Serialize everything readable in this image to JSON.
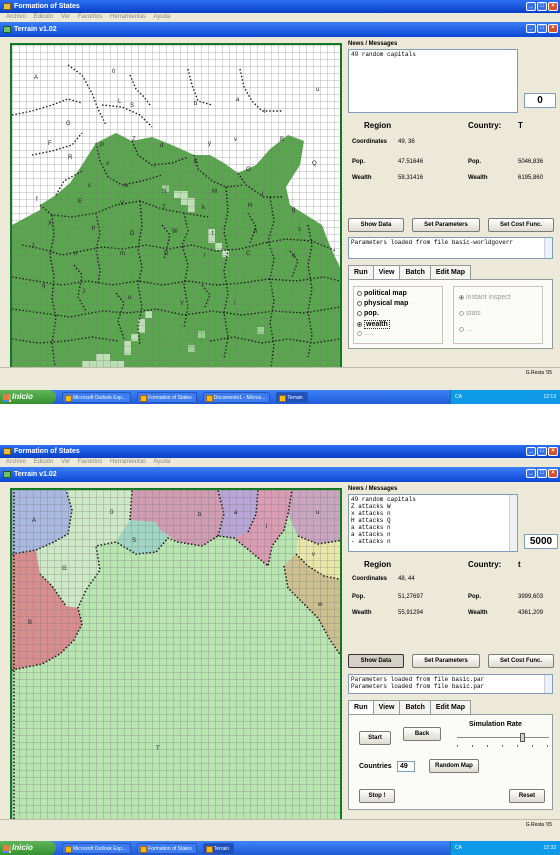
{
  "shot1": {
    "outer_title": "Formation of States",
    "menu": "Archivo Edición Ver Favoritos Herramientas Ayuda",
    "inner_title": "Terrain v1.02",
    "news_title": "News / Messages",
    "messages": [
      "49 random capitals"
    ],
    "counter": "0",
    "region_label": "Region",
    "country_label": "Country:",
    "country_value": "T",
    "coordinates_label": "Coordinates",
    "coordinates_value": "49, 36",
    "pop_label": "Pop.",
    "region_pop": "47.51646",
    "country_pop": "5046,836",
    "wealth_label": "Wealth",
    "region_wealth": "58,31416",
    "country_wealth": "6195,860",
    "btn_show_data": "Show Data",
    "btn_set_params": "Set Parameters",
    "btn_set_cost": "Set Cost Func.",
    "params_text": "Parameters loaded from file basic-worldgoverr",
    "tabs": [
      "Run",
      "View",
      "Batch",
      "Edit Map"
    ],
    "view_options": [
      "political map",
      "physical map",
      "pop.",
      "wealth",
      "....."
    ],
    "inspect_options": [
      "instant inspect",
      "stats",
      "..."
    ],
    "status_right": "G.Resta '05",
    "map_labels": [
      "A",
      "0",
      "L",
      "S",
      "b",
      "a",
      "l",
      "u",
      "G",
      "F",
      "P",
      "Z",
      "d",
      "y",
      "v",
      "B",
      "R",
      "x",
      "r",
      "K",
      "O",
      "Q",
      "c",
      "w",
      "N",
      "M",
      "j",
      "f",
      "E",
      "V",
      "T",
      "k",
      "H",
      "g",
      "X",
      "p",
      "D",
      "W",
      "t",
      "h",
      "s",
      "z",
      "n",
      "m",
      "U",
      "I",
      "C",
      "e",
      "q",
      "J",
      "o",
      "Y",
      "i"
    ],
    "taskbar": {
      "start": "Inicio",
      "items": [
        "Microsoft Outlook Exp...",
        "Formation of States",
        "Documento1 - Micros...",
        "Terrain"
      ],
      "tray": "CA",
      "clock": "12:13"
    }
  },
  "shot2": {
    "outer_title": "Formation of States",
    "menu": "Archivo Edición Ver Favoritos Herramientas Ayuda",
    "inner_title": "Terrain v1.02",
    "news_title": "News / Messages",
    "messages": [
      "49 random capitals",
      "Z attacks W",
      "x attacks n",
      "H attacks Q",
      "a attacks n",
      "a attacks n",
      "- attacks n"
    ],
    "counter": "5000",
    "region_label": "Region",
    "country_label": "Country:",
    "country_value": "t",
    "coordinates_label": "Coordinates",
    "coordinates_value": "48, 44",
    "pop_label": "Pop.",
    "region_pop": "51,27697",
    "country_pop": "3999,603",
    "wealth_label": "Wealth",
    "region_wealth": "55,91294",
    "country_wealth": "4361,209",
    "btn_show_data": "Show Data",
    "btn_set_params": "Set Parameters",
    "btn_set_cost": "Set Cost Func.",
    "params_lines": [
      "Parameters loaded from file basic.par",
      "Parameters loaded from file basic.par"
    ],
    "tabs": [
      "Run",
      "View",
      "Batch",
      "Edit Map"
    ],
    "btn_start": "Start",
    "btn_back": "Back",
    "sim_rate_label": "Simulation Rate",
    "sim_rate_level": 0.72,
    "countries_label": "Countries",
    "countries_value": "49",
    "btn_random_map": "Random Map",
    "btn_stop": "Stop !",
    "btn_reset": "Reset",
    "status_right": "G.Resta '05",
    "map_labels": [
      "A",
      "0",
      "S",
      "G",
      "b",
      "a",
      "l",
      "u",
      "v",
      "w",
      "B",
      "T"
    ],
    "region_colors": {
      "A": "#a9b9df",
      "0": "#cde8c5",
      "S": "#9fd6c4",
      "G": "#cde8c5",
      "b": "#cf9cb2",
      "a": "#b8a6d6",
      "l": "#d99cb2",
      "u": "#c9a5bf",
      "v": "#e9e6a9",
      "w": "#cdbf8f",
      "B": "#d88e8e",
      "T": "#b9e5b1"
    },
    "taskbar": {
      "start": "Inicio",
      "items": [
        "Microsoft Outlook Exp...",
        "Formation of States",
        "Terrain"
      ],
      "tray": "CA",
      "clock": "12:33"
    }
  },
  "colors": {
    "titlebar": "#0a3fc8",
    "map_green": "#5aa64e",
    "map_border": "#0f7a24"
  }
}
